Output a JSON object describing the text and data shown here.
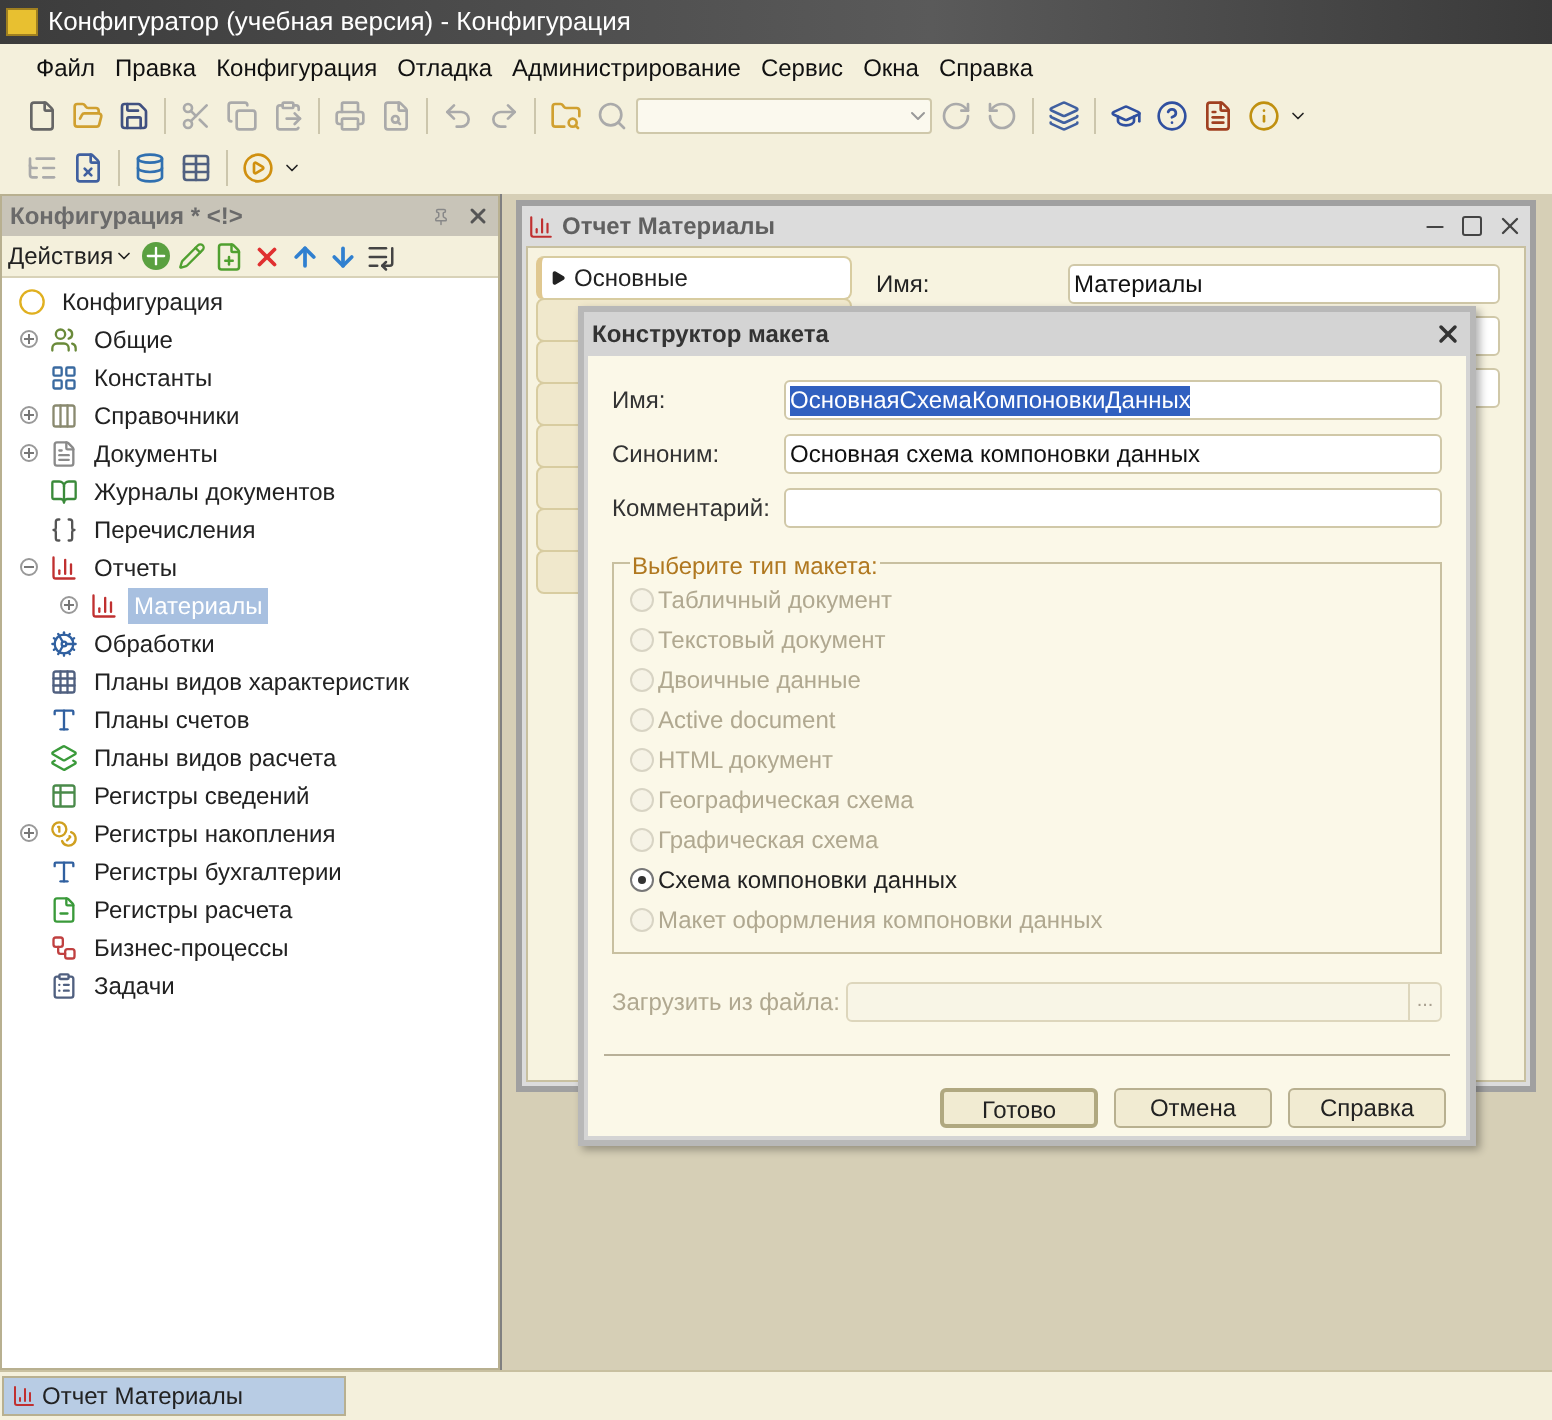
{
  "window": {
    "title": "Конфигуратор (учебная версия) - Конфигурация"
  },
  "menu": [
    {
      "label": "Файл"
    },
    {
      "label": "Правка"
    },
    {
      "label": "Конфигурация"
    },
    {
      "label": "Отладка"
    },
    {
      "label": "Администрирование"
    },
    {
      "label": "Сервис"
    },
    {
      "label": "Окна"
    },
    {
      "label": "Справка"
    }
  ],
  "config_panel": {
    "title": "Конфигурация * <!>",
    "actions_label": "Действия",
    "tree": [
      {
        "label": "Конфигурация",
        "selected": false,
        "children": [
          {
            "label": "Общие",
            "expanded": false,
            "selected": false
          },
          {
            "label": "Константы",
            "selected": false
          },
          {
            "label": "Справочники",
            "expanded": false,
            "selected": false
          },
          {
            "label": "Документы",
            "expanded": false,
            "selected": false
          },
          {
            "label": "Журналы документов",
            "selected": false
          },
          {
            "label": "Перечисления",
            "selected": false
          },
          {
            "label": "Отчеты",
            "expanded": true,
            "selected": false,
            "children": [
              {
                "label": "Материалы",
                "expanded": false,
                "selected": true
              }
            ]
          },
          {
            "label": "Обработки",
            "selected": false
          },
          {
            "label": "Планы видов характеристик",
            "selected": false
          },
          {
            "label": "Планы счетов",
            "selected": false
          },
          {
            "label": "Планы видов расчета",
            "selected": false
          },
          {
            "label": "Регистры сведений",
            "selected": false
          },
          {
            "label": "Регистры накопления",
            "expanded": false,
            "selected": false
          },
          {
            "label": "Регистры бухгалтерии",
            "selected": false
          },
          {
            "label": "Регистры расчета",
            "selected": false
          },
          {
            "label": "Бизнес-процессы",
            "selected": false
          },
          {
            "label": "Задачи",
            "selected": false
          }
        ]
      }
    ]
  },
  "report_window": {
    "title": "Отчет Материалы",
    "tabs": [
      {
        "label": "Основные",
        "selected": true
      }
    ],
    "name_label": "Имя:",
    "name_value": "Материалы"
  },
  "dialog": {
    "title": "Конструктор макета",
    "fields": [
      {
        "label": "Имя:",
        "value": "ОсновнаяСхемаКомпоновкиДанных",
        "highlighted": true
      },
      {
        "label": "Синоним:",
        "value": "Основная схема компоновки данных",
        "highlighted": false
      },
      {
        "label": "Комментарий:"
      }
    ],
    "group_title": "Выберите тип макета:",
    "options": [
      {
        "label": "Табличный документ",
        "selected": false,
        "disabled": true
      },
      {
        "label": "Текстовый документ",
        "selected": false,
        "disabled": true
      },
      {
        "label": "Двоичные данные",
        "selected": false,
        "disabled": true
      },
      {
        "label": "Active document",
        "selected": false,
        "disabled": true
      },
      {
        "label": "HTML документ",
        "selected": false,
        "disabled": true
      },
      {
        "label": "Географическая схема",
        "selected": false,
        "disabled": true
      },
      {
        "label": "Графическая схема",
        "selected": false,
        "disabled": true
      },
      {
        "label": "Схема компоновки данных",
        "selected": true,
        "disabled": false
      },
      {
        "label": "Макет оформления компоновки данных",
        "selected": false,
        "disabled": true
      }
    ],
    "file_label": "Загрузить из файла:",
    "file_disabled": true,
    "browse_label": "...",
    "buttons": [
      {
        "label": "Готово",
        "default": true
      },
      {
        "label": "Отмена",
        "default": false
      },
      {
        "label": "Справка",
        "default": false
      }
    ]
  },
  "taskbar": [
    {
      "label": "Отчет Материалы",
      "selected": true
    }
  ]
}
